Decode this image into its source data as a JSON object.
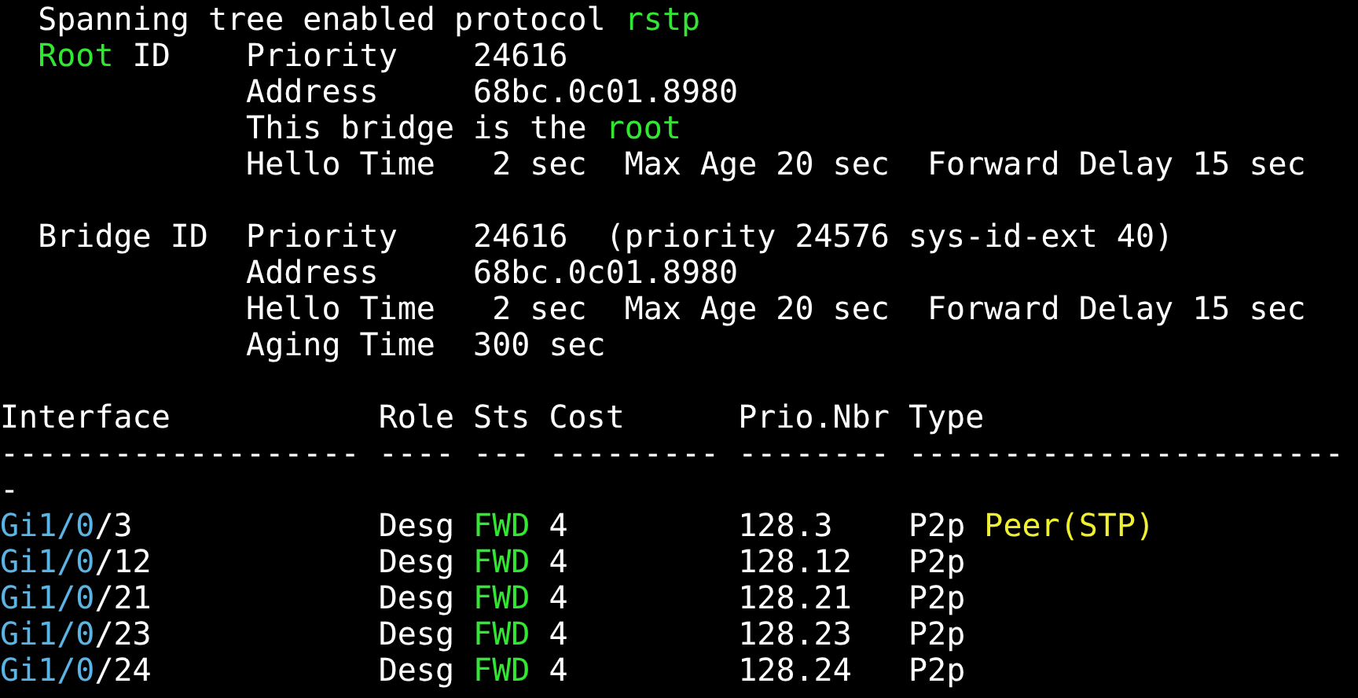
{
  "lines": [
    {
      "kind": "text",
      "segments": [
        {
          "text": "  Spanning tree enabled protocol ",
          "color": "#ffffff"
        },
        {
          "text": "rstp",
          "color": "#33e633"
        }
      ]
    },
    {
      "kind": "text",
      "segments": [
        {
          "text": "  Root",
          "color": "#33e633"
        },
        {
          "text": " ID    Priority    24616",
          "color": "#ffffff"
        }
      ]
    },
    {
      "kind": "text",
      "segments": [
        {
          "text": "             Address     68bc.0c01.8980",
          "color": "#ffffff"
        }
      ]
    },
    {
      "kind": "text",
      "segments": [
        {
          "text": "             This bridge is the ",
          "color": "#ffffff"
        },
        {
          "text": "root",
          "color": "#33e633"
        }
      ]
    },
    {
      "kind": "text",
      "segments": [
        {
          "text": "             Hello Time   2 sec  Max Age 20 sec  Forward Delay 15 sec",
          "color": "#ffffff"
        }
      ]
    },
    {
      "kind": "blank"
    },
    {
      "kind": "text",
      "segments": [
        {
          "text": "  Bridge ID  Priority    24616  (priority 24576 sys-id-ext 40)",
          "color": "#ffffff"
        }
      ]
    },
    {
      "kind": "text",
      "segments": [
        {
          "text": "             Address     68bc.0c01.8980",
          "color": "#ffffff"
        }
      ]
    },
    {
      "kind": "text",
      "segments": [
        {
          "text": "             Hello Time   2 sec  Max Age 20 sec  Forward Delay 15 sec",
          "color": "#ffffff"
        }
      ]
    },
    {
      "kind": "text",
      "segments": [
        {
          "text": "             Aging Time  300 sec",
          "color": "#ffffff"
        }
      ]
    },
    {
      "kind": "blank"
    },
    {
      "kind": "text",
      "segments": [
        {
          "text": "Interface           Role Sts Cost      Prio.Nbr Type",
          "color": "#ffffff"
        }
      ]
    },
    {
      "kind": "text",
      "segments": [
        {
          "text": "------------------- ---- --- --------- -------- -----------------------",
          "color": "#ffffff"
        }
      ]
    },
    {
      "kind": "text",
      "segments": [
        {
          "text": "-",
          "color": "#ffffff"
        }
      ]
    },
    {
      "kind": "text",
      "segments": [
        {
          "text": "Gi1/0",
          "color": "#5ab4e6"
        },
        {
          "text": "/3             Desg ",
          "color": "#ffffff"
        },
        {
          "text": "FWD",
          "color": "#33e633"
        },
        {
          "text": " 4         128.3    P2p ",
          "color": "#ffffff"
        },
        {
          "text": "Peer(STP)",
          "color": "#f0f033"
        }
      ]
    },
    {
      "kind": "text",
      "segments": [
        {
          "text": "Gi1/0",
          "color": "#5ab4e6"
        },
        {
          "text": "/12            Desg ",
          "color": "#ffffff"
        },
        {
          "text": "FWD",
          "color": "#33e633"
        },
        {
          "text": " 4         128.12   P2p",
          "color": "#ffffff"
        }
      ]
    },
    {
      "kind": "text",
      "segments": [
        {
          "text": "Gi1/0",
          "color": "#5ab4e6"
        },
        {
          "text": "/21            Desg ",
          "color": "#ffffff"
        },
        {
          "text": "FWD",
          "color": "#33e633"
        },
        {
          "text": " 4         128.21   P2p",
          "color": "#ffffff"
        }
      ]
    },
    {
      "kind": "text",
      "segments": [
        {
          "text": "Gi1/0",
          "color": "#5ab4e6"
        },
        {
          "text": "/23            Desg ",
          "color": "#ffffff"
        },
        {
          "text": "FWD",
          "color": "#33e633"
        },
        {
          "text": " 4         128.23   P2p",
          "color": "#ffffff"
        }
      ]
    },
    {
      "kind": "text",
      "segments": [
        {
          "text": "Gi1/0",
          "color": "#5ab4e6"
        },
        {
          "text": "/24            Desg ",
          "color": "#ffffff"
        },
        {
          "text": "FWD",
          "color": "#33e633"
        },
        {
          "text": " 4         128.24   P2p",
          "color": "#ffffff"
        }
      ]
    }
  ]
}
